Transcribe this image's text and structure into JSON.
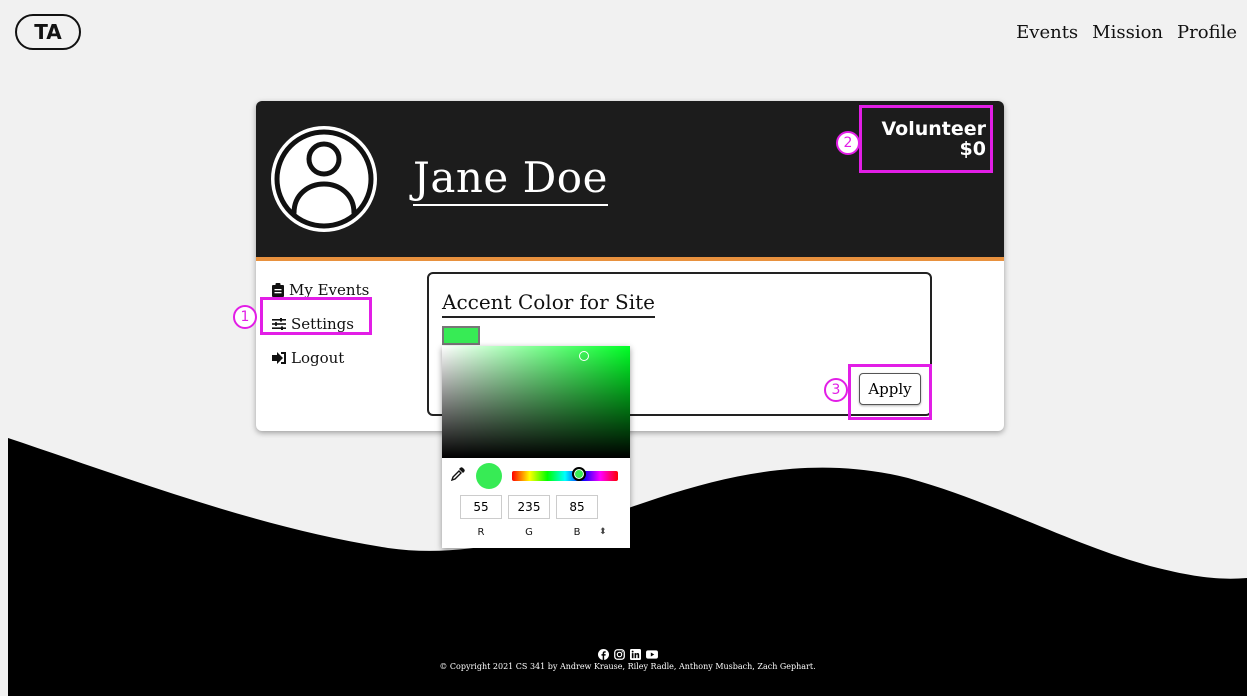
{
  "header": {
    "logo": "TA",
    "nav": [
      "Events",
      "Mission",
      "Profile"
    ]
  },
  "profile": {
    "name": "Jane Doe",
    "role": "Volunteer",
    "amount": "$0"
  },
  "sidebar": {
    "items": [
      {
        "label": "My Events",
        "icon": "clipboard-icon"
      },
      {
        "label": "Settings",
        "icon": "sliders-icon"
      },
      {
        "label": "Logout",
        "icon": "logout-icon"
      }
    ]
  },
  "settings": {
    "title": "Accent Color for Site",
    "accent_color": "#37eb55",
    "apply_label": "Apply"
  },
  "color_picker": {
    "r": "55",
    "g": "235",
    "b": "85",
    "labels": [
      "R",
      "G",
      "B"
    ]
  },
  "annotations": [
    "1",
    "2",
    "3"
  ],
  "footer": {
    "copyright": "© Copyright 2021 CS 341 by Andrew Krause, Riley Radle, Anthony Musbach, Zach Gephart.",
    "social_icons": [
      "facebook-icon",
      "instagram-icon",
      "linkedin-icon",
      "youtube-icon"
    ]
  },
  "colors": {
    "annotation": "#e21ee6",
    "header_bg": "#1c1c1c",
    "header_border": "#e8913e"
  }
}
